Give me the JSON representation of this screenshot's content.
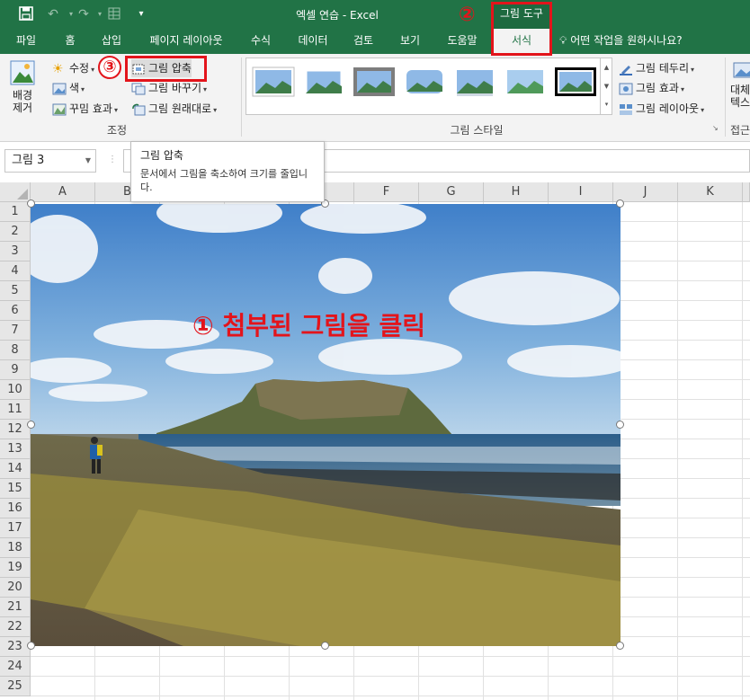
{
  "titlebar": {
    "title": "엑셀 연습  -  Excel",
    "context_tab": "그림 도구"
  },
  "tabs": [
    "파일",
    "홈",
    "삽입",
    "페이지 레이아웃",
    "수식",
    "데이터",
    "검토",
    "보기",
    "도움말",
    "서식"
  ],
  "active_tab": "서식",
  "tell_me": "어떤 작업을 원하시나요?",
  "ribbon": {
    "remove_bg": {
      "line1": "배경",
      "line2": "제거"
    },
    "adjust": {
      "corrections": "수정",
      "color": "색",
      "artistic": "꾸밈 효과",
      "compress": "그림 압축",
      "change": "그림 바꾸기",
      "reset": "그림 원래대로",
      "group_label": "조정"
    },
    "styles": {
      "border": "그림 테두리",
      "effects": "그림 효과",
      "layout": "그림 레이아웃",
      "group_label": "그림 스타일"
    },
    "accessibility": {
      "line1": "대체",
      "line2": "텍스",
      "group_label": "접근"
    }
  },
  "formula_bar": {
    "name_box": "그림 3"
  },
  "tooltip": {
    "title": "그림 압축",
    "description": "문서에서 그림을 축소하여 크기를 줄입니다."
  },
  "grid": {
    "columns": [
      "A",
      "B",
      "C",
      "D",
      "E",
      "F",
      "G",
      "H",
      "I",
      "J",
      "K"
    ],
    "rows": [
      "1",
      "2",
      "3",
      "4",
      "5",
      "6",
      "7",
      "8",
      "9",
      "10",
      "11",
      "12",
      "13",
      "14",
      "15",
      "16",
      "17",
      "18",
      "19",
      "20",
      "21",
      "22",
      "23",
      "24",
      "25"
    ]
  },
  "annotations": {
    "step1": "① 첨부된 그림을 클릭",
    "step2": "②",
    "step3": "③"
  },
  "colors": {
    "excel_green": "#217346",
    "annotation_red": "#e3141b"
  }
}
